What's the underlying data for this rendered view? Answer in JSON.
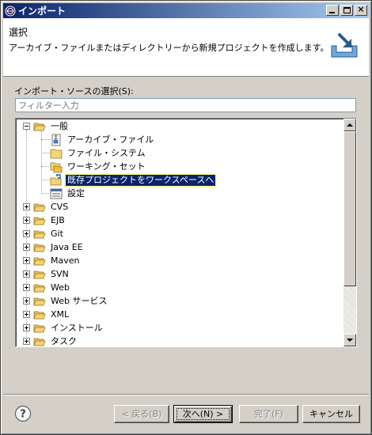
{
  "window": {
    "title": "インポート",
    "close_glyph": "×"
  },
  "header": {
    "title": "選択",
    "description": "アーカイブ・ファイルまたはディレクトリーから新規プロジェクトを作成します。"
  },
  "source": {
    "label": "インポート・ソースの選択(S):",
    "filter_placeholder": "フィルター入力"
  },
  "tree": {
    "expanded_group": {
      "label": "一般",
      "children": [
        {
          "label": "アーカイブ・ファイル",
          "icon": "archive-file-icon"
        },
        {
          "label": "ファイル・システム",
          "icon": "folder-icon"
        },
        {
          "label": "ワーキング・セット",
          "icon": "working-set-icon"
        },
        {
          "label": "既存プロジェクトをワークスペースへ",
          "icon": "existing-project-icon",
          "selected": true
        },
        {
          "label": "設定",
          "icon": "preferences-icon"
        }
      ]
    },
    "collapsed_groups": [
      "CVS",
      "EJB",
      "Git",
      "Java EE",
      "Maven",
      "SVN",
      "Web",
      "Web サービス",
      "XML",
      "インストール",
      "タスク"
    ]
  },
  "buttons": {
    "back": "< 戻る(B)",
    "next": "次へ(N) >",
    "finish": "完了(F)",
    "cancel": "キャンセル"
  },
  "colors": {
    "title_bar": "#0a246a",
    "selection": "#0a246a",
    "folder": "#f5d478"
  }
}
